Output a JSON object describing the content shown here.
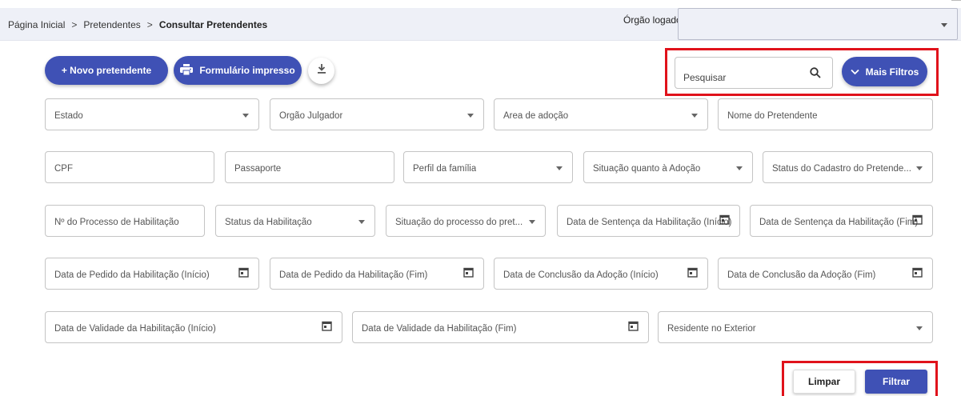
{
  "breadcrumb": {
    "items": [
      "Página Inicial",
      "Pretendentes"
    ],
    "separator": ">",
    "current": "Consultar Pretendentes"
  },
  "orgao": {
    "label": "Órgão logado",
    "value": ""
  },
  "actions": {
    "novo_label": "+ Novo pretendente",
    "formulario_label": "Formulário impresso"
  },
  "search": {
    "placeholder": "Pesquisar",
    "mais_filtros_label": "Mais Filtros"
  },
  "filters": {
    "row1": [
      "Estado",
      "Órgão Julgador",
      "Área de adoção",
      "Nome do Pretendente"
    ],
    "row2": [
      "CPF",
      "Passaporte",
      "Perfil da família",
      "Situação quanto à Adoção",
      "Status do Cadastro do Pretende..."
    ],
    "row3": [
      "Nº do Processo de Habilitação",
      "Status da Habilitação",
      "Situação do processo do pret...",
      "Data de Sentença da Habilitação (Início)",
      "Data de Sentença da Habilitação (Fim)"
    ],
    "row4": [
      "Data de Pedido da Habilitação (Início)",
      "Data de Pedido da Habilitação (Fim)",
      "Data de Conclusão da Adoção (Início)",
      "Data de Conclusão da Adoção (Fim)"
    ],
    "row5": [
      "Data de Validade da Habilitação (Início)",
      "Data de Validade da Habilitação (Fim)",
      "Residente no Exterior"
    ]
  },
  "footer": {
    "limpar_label": "Limpar",
    "filtrar_label": "Filtrar"
  },
  "colors": {
    "primary": "#3f51b5",
    "highlight": "#e0121b",
    "header_bg": "#eef0f7"
  }
}
